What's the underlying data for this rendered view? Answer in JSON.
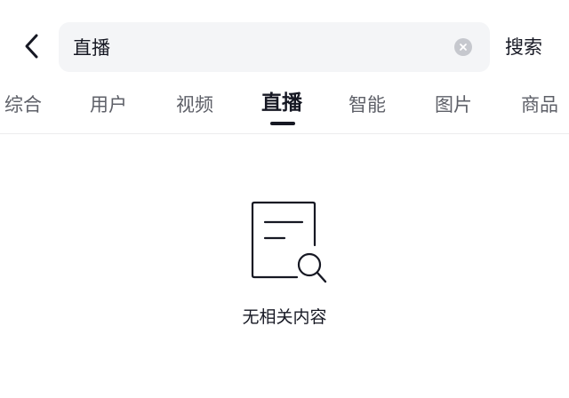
{
  "search": {
    "value": "直播",
    "action_label": "搜索"
  },
  "tabs": [
    {
      "label": "综合",
      "active": false
    },
    {
      "label": "用户",
      "active": false
    },
    {
      "label": "视频",
      "active": false
    },
    {
      "label": "直播",
      "active": true
    },
    {
      "label": "智能",
      "active": false
    },
    {
      "label": "图片",
      "active": false
    },
    {
      "label": "商品",
      "active": false
    }
  ],
  "empty_state": {
    "icon": "document-search-icon",
    "message": "无相关内容"
  },
  "icons": {
    "back": "chevron-left-icon",
    "clear": "clear-icon"
  },
  "colors": {
    "text_primary": "#161823",
    "text_secondary": "#5e6068",
    "search_bg": "#f4f5f7",
    "clear_bg": "#c6c8ce"
  }
}
